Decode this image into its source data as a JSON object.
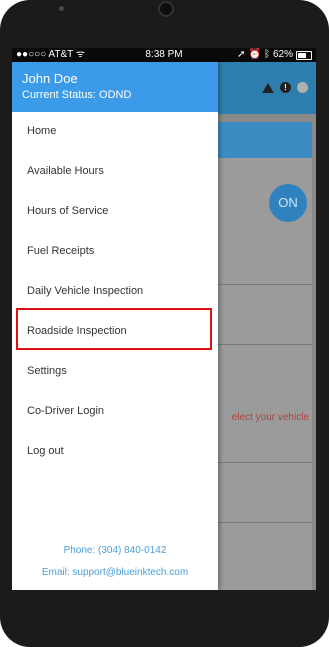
{
  "status_bar": {
    "carrier": "●●○○○ AT&T ᯤ",
    "time": "8:38 PM",
    "battery": "62%",
    "icons_left_of_battery": [
      "location-arrow-icon",
      "alarm-icon",
      "bluetooth-icon"
    ]
  },
  "drawer": {
    "user_name": "John Doe",
    "current_status": "Current Status: ODND",
    "menu_items": [
      {
        "label": "Home"
      },
      {
        "label": "Available Hours"
      },
      {
        "label": "Hours of Service"
      },
      {
        "label": "Fuel Receipts"
      },
      {
        "label": "Daily Vehicle Inspection"
      },
      {
        "label": "Roadside Inspection",
        "highlighted": true
      },
      {
        "label": "Settings"
      },
      {
        "label": "Co-Driver Login"
      },
      {
        "label": "Log out"
      }
    ],
    "phone": "Phone: (304) 840-0142",
    "email": "Email: support@blueinktech.com"
  },
  "background_app": {
    "toggle_label": "ON",
    "select_text": "elect your vehicle",
    "header_icons": [
      "warning-triangle-icon",
      "alert-circle-icon",
      "status-dot-icon"
    ]
  },
  "colors": {
    "drawer_header": "#3b9be8",
    "contact_text": "#4a9fd8",
    "highlight_border": "#e01010",
    "app_header": "#2f7fae"
  }
}
